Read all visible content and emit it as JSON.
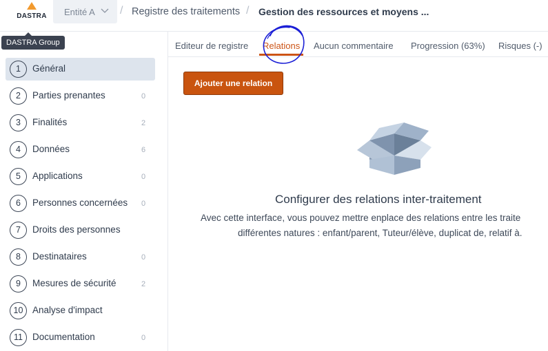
{
  "header": {
    "logo_text": "DASTRA",
    "entity_select": {
      "value": "Entité A"
    },
    "breadcrumb": [
      "Registre des traitements",
      "Gestion des ressources et moyens ..."
    ],
    "separator": "/"
  },
  "tooltip": {
    "text": "DASTRA Group"
  },
  "sidebar": {
    "items": [
      {
        "num": "1",
        "label": "Général",
        "count": "",
        "active": true
      },
      {
        "num": "2",
        "label": "Parties prenantes",
        "count": "0"
      },
      {
        "num": "3",
        "label": "Finalités",
        "count": "2"
      },
      {
        "num": "4",
        "label": "Données",
        "count": "6"
      },
      {
        "num": "5",
        "label": "Applications",
        "count": "0"
      },
      {
        "num": "6",
        "label": "Personnes concernées",
        "count": "0"
      },
      {
        "num": "7",
        "label": "Droits des personnes",
        "count": ""
      },
      {
        "num": "8",
        "label": "Destinataires",
        "count": "0"
      },
      {
        "num": "9",
        "label": "Mesures de sécurité",
        "count": "2"
      },
      {
        "num": "10",
        "label": "Analyse d'impact",
        "count": ""
      },
      {
        "num": "11",
        "label": "Documentation",
        "count": "0"
      }
    ]
  },
  "tabs": [
    {
      "label": "Editeur de registre"
    },
    {
      "label": "Relations",
      "active": true
    },
    {
      "label": "Aucun commentaire"
    },
    {
      "label": "Progression (63%)"
    },
    {
      "label": "Risques (-)"
    }
  ],
  "main": {
    "add_button": "Ajouter une relation",
    "empty_title": "Configurer des relations inter-traitement",
    "empty_desc_line1": "Avec cette interface, vous pouvez mettre enplace des relations entre les traite",
    "empty_desc_line2": "différentes natures : enfant/parent, Tuteur/élève, duplicat de, relatif à."
  },
  "icons": [
    "dastra-logo-icon",
    "chevron-down-icon",
    "empty-box-icon"
  ],
  "colors": {
    "accent": "#cc5416",
    "button": "#c9540f",
    "logo_triangle": "#f29a2e",
    "active_item_bg": "#dde4ed",
    "annotation": "#1b1fd6"
  }
}
